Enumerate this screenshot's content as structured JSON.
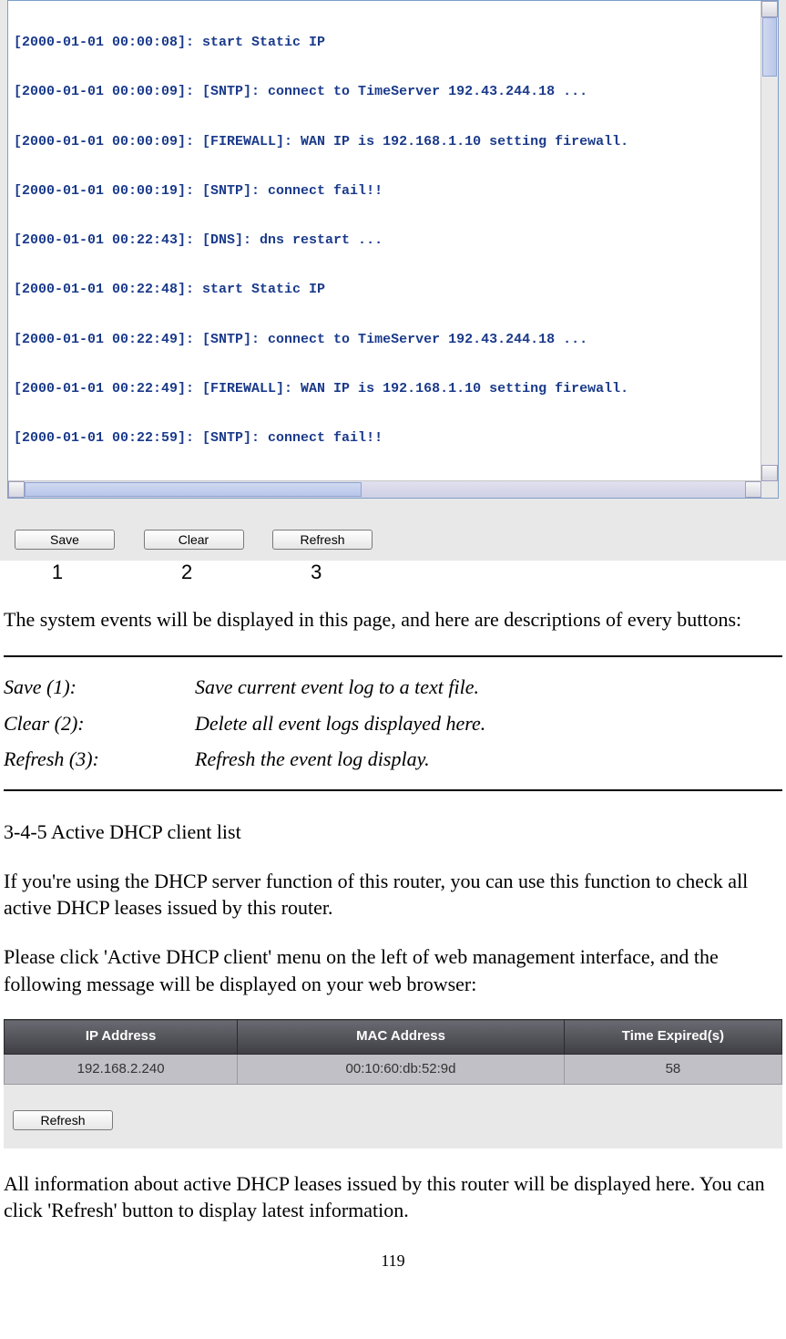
{
  "log": {
    "lines": [
      "[2000-01-01 00:00:08]: start Static IP",
      "[2000-01-01 00:00:09]: [SNTP]: connect to TimeServer 192.43.244.18 ...",
      "[2000-01-01 00:00:09]: [FIREWALL]: WAN IP is 192.168.1.10 setting firewall.",
      "[2000-01-01 00:00:19]: [SNTP]: connect fail!!",
      "[2000-01-01 00:22:43]: [DNS]: dns restart ...",
      "[2000-01-01 00:22:48]: start Static IP",
      "[2000-01-01 00:22:49]: [SNTP]: connect to TimeServer 192.43.244.18 ...",
      "[2000-01-01 00:22:49]: [FIREWALL]: WAN IP is 192.168.1.10 setting firewall.",
      "[2000-01-01 00:22:59]: [SNTP]: connect fail!!"
    ]
  },
  "buttons": {
    "save": "Save",
    "clear": "Clear",
    "refresh": "Refresh"
  },
  "nums": {
    "n1": "1",
    "n2": "2",
    "n3": "3"
  },
  "text": {
    "intro": "The system events will be displayed in this page, and here are descriptions of every buttons:",
    "defs": [
      {
        "label": "Save (1):",
        "desc": "Save current event log to a text file."
      },
      {
        "label": "Clear (2):",
        "desc": "Delete all event logs displayed here."
      },
      {
        "label": "Refresh (3):",
        "desc": "Refresh the event log display."
      }
    ],
    "section_heading": "3-4-5 Active DHCP client list",
    "p1": "If you're using the DHCP server function of this router, you can use this function to check all active DHCP leases issued by this router.",
    "p2": "Please click 'Active DHCP client' menu on the left of web management interface, and the following message will be displayed on your web browser:",
    "p3": "All information about active DHCP leases issued by this router will be displayed here. You can click 'Refresh' button to display latest information."
  },
  "dhcp": {
    "headers": {
      "ip": "IP Address",
      "mac": "MAC Address",
      "expire": "Time Expired(s)"
    },
    "rows": [
      {
        "ip": "192.168.2.240",
        "mac": "00:10:60:db:52:9d",
        "expire": "58"
      }
    ],
    "refresh": "Refresh"
  },
  "pagenum": "119"
}
